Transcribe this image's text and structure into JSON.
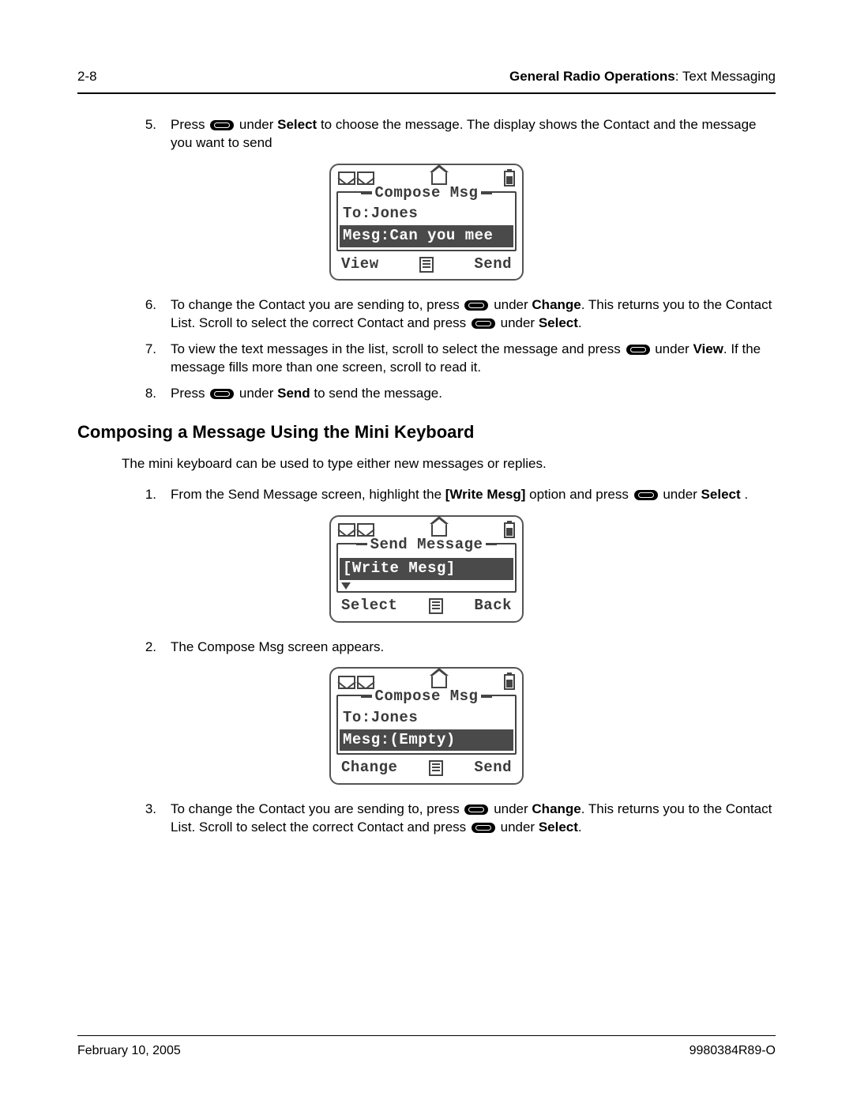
{
  "header": {
    "page_num": "2-8",
    "section_bold": "General Radio Operations",
    "section_rest": ": Text Messaging"
  },
  "steps_a": [
    {
      "n": "5.",
      "pre": "Press ",
      "mid": " under ",
      "b1": "Select",
      "post": " to choose the message. The display shows the Contact and the message you want to send"
    },
    {
      "n": "6.",
      "pre": "To change the Contact you are sending to, press ",
      "mid": " under ",
      "b1": "Change",
      "post": ". This returns you to the Contact List. Scroll to select the correct Contact and press ",
      "mid2": " under ",
      "b2": "Select",
      "post2": "."
    },
    {
      "n": "7.",
      "pre": "To view the text messages in the list, scroll to select the message and press ",
      "mid": " under ",
      "b1": "View",
      "post": ". If the message fills more than one screen, scroll to read it."
    },
    {
      "n": "8.",
      "pre": "Press ",
      "mid": " under ",
      "b1": "Send",
      "post": " to send the message."
    }
  ],
  "section_title": "Composing a Message Using the Mini Keyboard",
  "intro_text": "The mini keyboard can be used to type either new messages or replies.",
  "steps_b": [
    {
      "n": "1.",
      "pre": "From the Send Message screen, highlight the ",
      "b0": "[Write Mesg]",
      "mid0": " option and press ",
      "mid": " under ",
      "b1": "Select",
      "post": " ."
    },
    {
      "n": "2.",
      "pre": "The Compose Msg screen appears."
    },
    {
      "n": "3.",
      "pre": "To change the Contact you are sending to, press ",
      "mid": " under ",
      "b1": "Change",
      "post": ". This returns you to the Contact List. Scroll to select the correct Contact and press ",
      "mid2": " under ",
      "b2": "Select",
      "post2": "."
    }
  ],
  "lcd1": {
    "title": "Compose Msg",
    "line1": "To:Jones",
    "line2": "Mesg:Can you mee",
    "left": "View",
    "right": "Send"
  },
  "lcd2": {
    "title": "Send Message",
    "line1": "[Write Mesg]",
    "left": "Select",
    "right": "Back"
  },
  "lcd3": {
    "title": "Compose Msg",
    "line1": "To:Jones",
    "line2": "Mesg:(Empty)",
    "left": "Change",
    "right": "Send"
  },
  "footer": {
    "date": "February 10, 2005",
    "docnum": "9980384R89-O"
  }
}
